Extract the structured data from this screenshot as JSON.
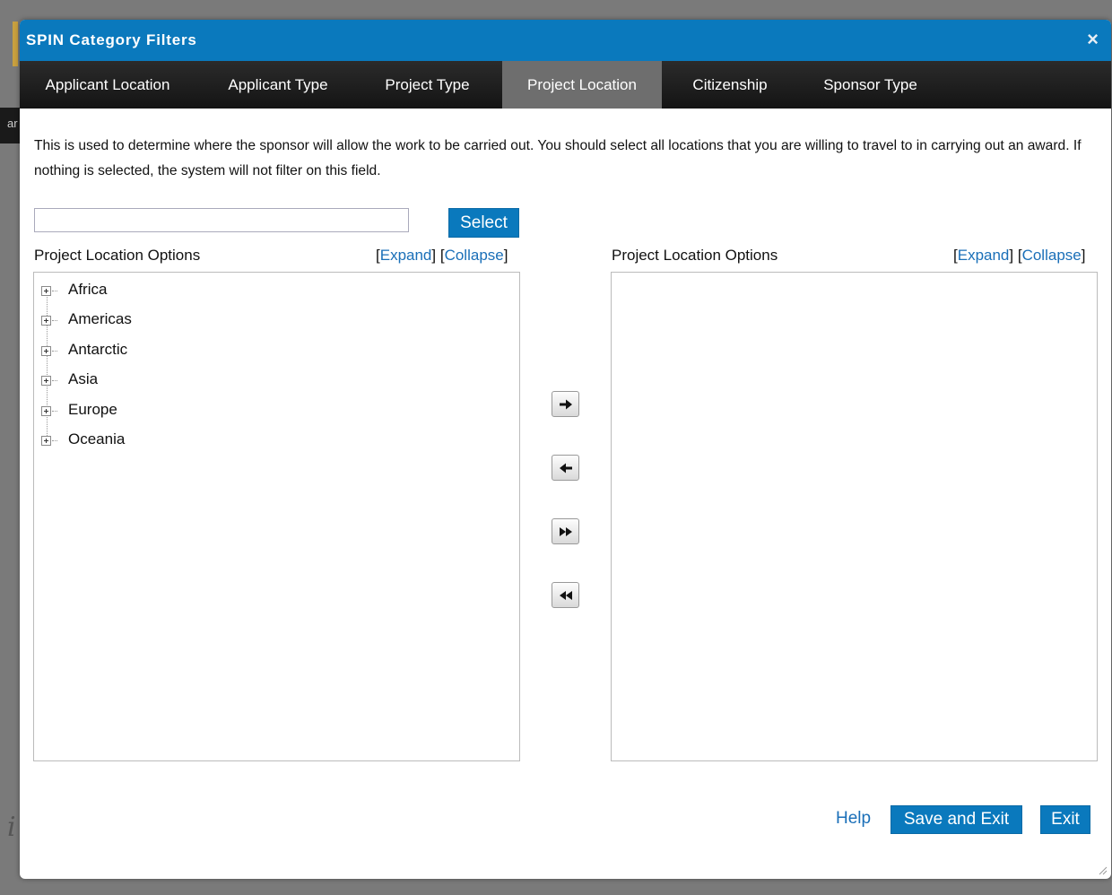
{
  "background": {
    "side_text": "ar",
    "italic_text": "i"
  },
  "dialog": {
    "title": "SPIN Category Filters",
    "close_glyph": "×",
    "tabs": [
      {
        "label": "Applicant Location",
        "active": false
      },
      {
        "label": "Applicant Type",
        "active": false
      },
      {
        "label": "Project Type",
        "active": false
      },
      {
        "label": "Project Location",
        "active": true
      },
      {
        "label": "Citizenship",
        "active": false
      },
      {
        "label": "Sponsor Type",
        "active": false
      }
    ],
    "description": "This is used to determine where the sponsor will allow the work to be carried out. You should select all locations that you are willing to travel to in carrying out an award. If nothing is selected, the system will not filter on this field.",
    "search": {
      "value": "",
      "placeholder": ""
    },
    "select_label": "Select",
    "left_panel": {
      "title": "Project Location Options",
      "expand": "Expand",
      "collapse": "Collapse",
      "items": [
        "Africa",
        "Americas",
        "Antarctic",
        "Asia",
        "Europe",
        "Oceania"
      ]
    },
    "right_panel": {
      "title": "Project Location Options",
      "expand": "Expand",
      "collapse": "Collapse",
      "items": []
    },
    "move_buttons": [
      "arrow-right-icon",
      "arrow-left-icon",
      "double-arrow-right-icon",
      "double-arrow-left-icon"
    ],
    "footer": {
      "help": "Help",
      "save_exit": "Save and Exit",
      "exit": "Exit"
    }
  },
  "colors": {
    "accent": "#0a79bd",
    "tabbar": "#1e1e1e",
    "active_tab": "#6e6e6e",
    "link": "#1a6fb8"
  }
}
